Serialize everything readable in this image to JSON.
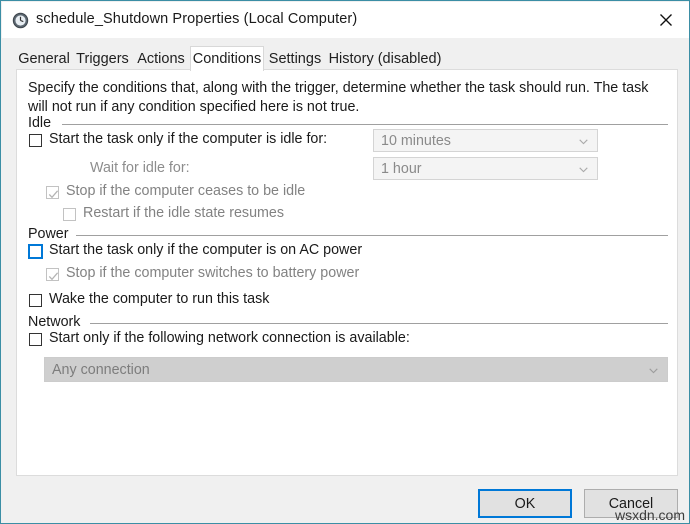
{
  "window": {
    "title": "schedule_Shutdown Properties (Local Computer)",
    "icon": "clock-icon",
    "close_label": "✕",
    "accent_border": "#3b8ea5"
  },
  "tabs": [
    {
      "label": "General",
      "selected": false
    },
    {
      "label": "Triggers",
      "selected": false
    },
    {
      "label": "Actions",
      "selected": false
    },
    {
      "label": "Conditions",
      "selected": true
    },
    {
      "label": "Settings",
      "selected": false
    },
    {
      "label": "History (disabled)",
      "selected": false
    }
  ],
  "panel": {
    "description": "Specify the conditions that, along with the trigger, determine whether the task should run.  The task will not run  if any condition specified here is not true.",
    "groups": {
      "idle": {
        "label": "Idle",
        "start_if_idle": {
          "label": "Start the task only if the computer is idle for:",
          "checked": false,
          "enabled": true
        },
        "idle_duration": {
          "value": "10 minutes",
          "enabled": false
        },
        "wait_for_idle_label": "Wait for idle for:",
        "wait_duration": {
          "value": "1 hour",
          "enabled": false
        },
        "stop_if_ceases": {
          "label": "Stop if the computer ceases to be idle",
          "checked": true,
          "enabled": false
        },
        "restart_if_resumes": {
          "label": "Restart if the idle state resumes",
          "checked": false,
          "enabled": false
        }
      },
      "power": {
        "label": "Power",
        "start_if_ac": {
          "label": "Start the task only if the computer is on AC power",
          "checked": false,
          "enabled": true,
          "focused": true
        },
        "stop_if_battery": {
          "label": "Stop if the computer switches to battery power",
          "checked": true,
          "enabled": false
        },
        "wake_computer": {
          "label": "Wake the computer to run this task",
          "checked": false,
          "enabled": true
        }
      },
      "network": {
        "label": "Network",
        "start_if_network": {
          "label": "Start only if the following network connection is available:",
          "checked": false,
          "enabled": true
        },
        "connection": {
          "value": "Any connection",
          "enabled": false
        }
      }
    }
  },
  "footer": {
    "ok_label": "OK",
    "cancel_label": "Cancel"
  },
  "watermark": "wsxdn.com"
}
